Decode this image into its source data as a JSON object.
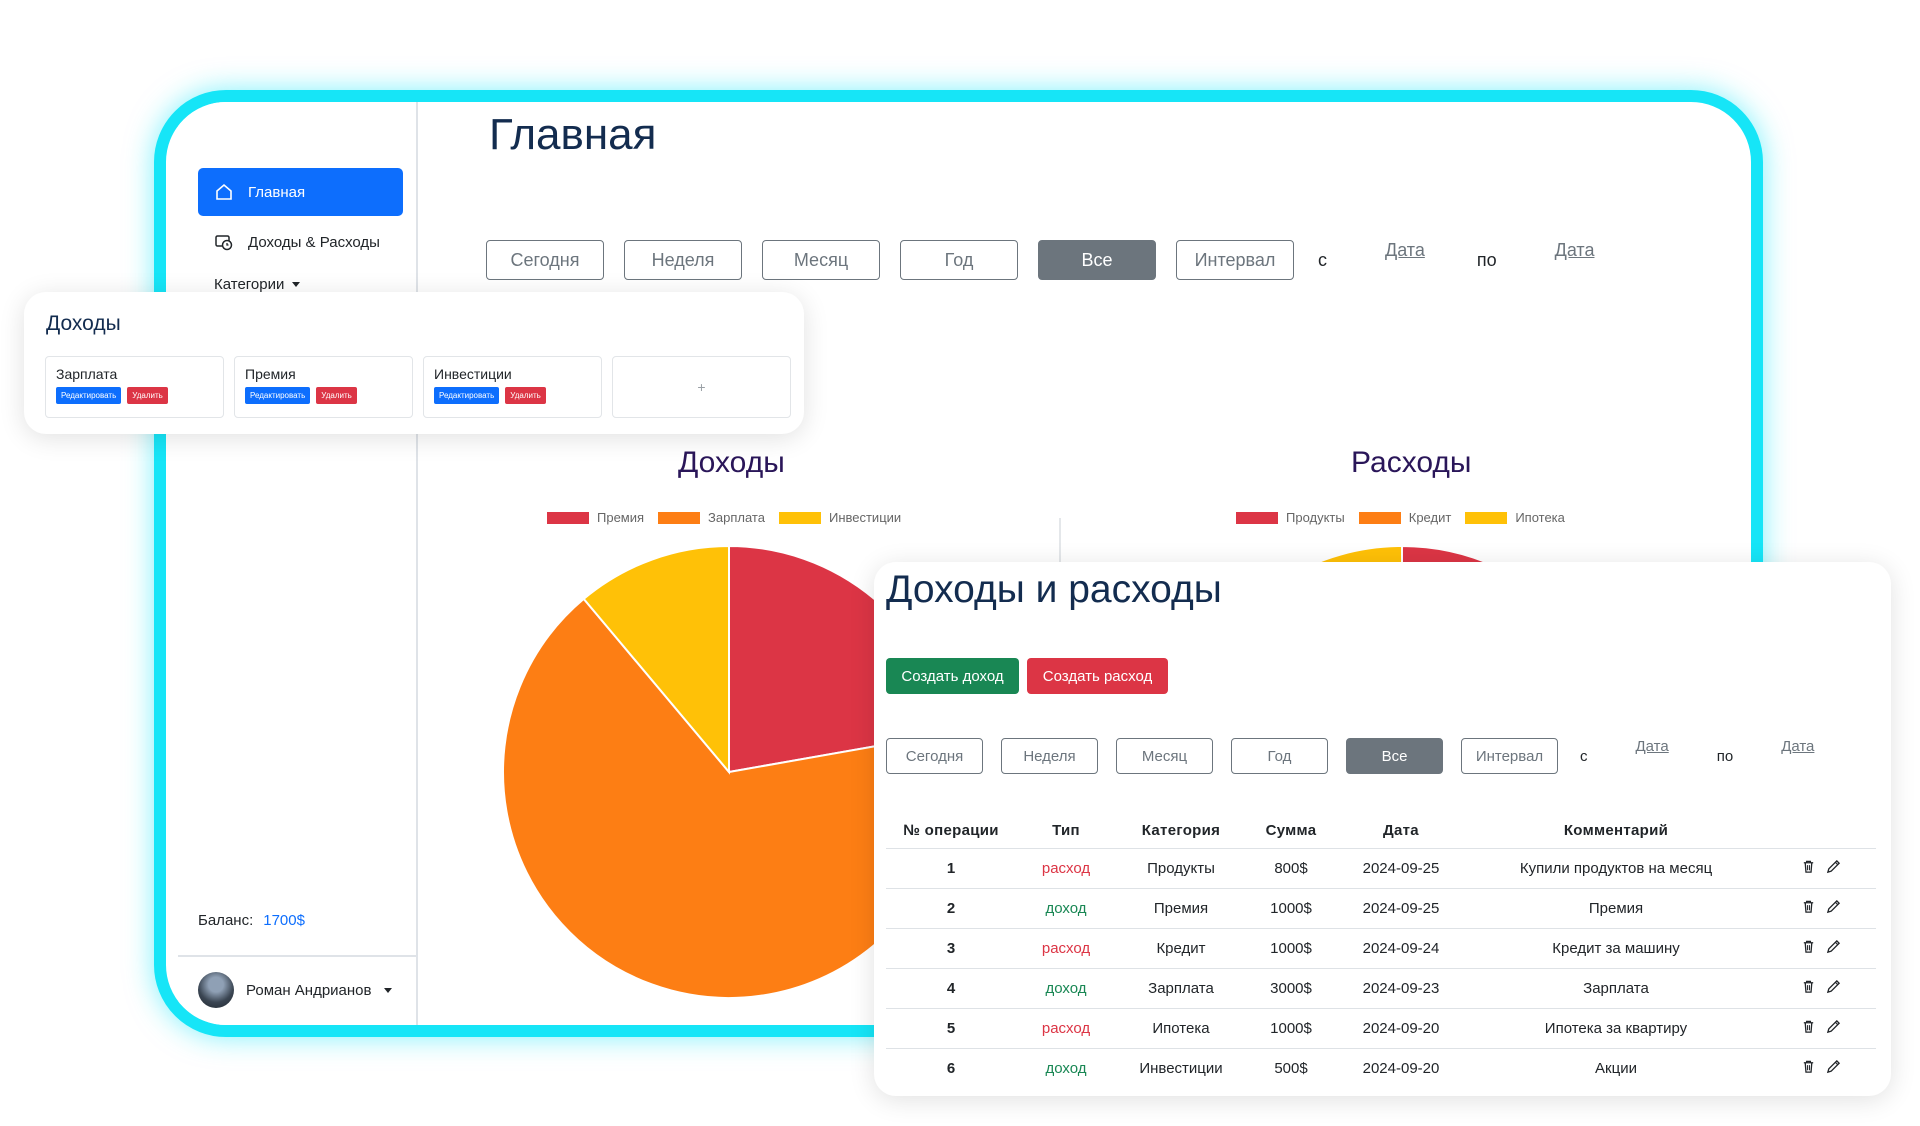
{
  "sidebar": {
    "items": [
      {
        "label": "Главная",
        "icon": "home-icon",
        "active": true
      },
      {
        "label": "Доходы & Расходы",
        "icon": "wallet-icon",
        "active": false
      }
    ],
    "categories_label": "Категории",
    "balance_label": "Баланс:",
    "balance_value": "1700$",
    "user_name": "Роман Андрианов"
  },
  "main": {
    "title": "Главная",
    "filters": {
      "buttons": [
        "Сегодня",
        "Неделя",
        "Месяц",
        "Год",
        "Все",
        "Интервал"
      ],
      "active": "Все",
      "from_label": "с",
      "to_label": "по",
      "date_from": "Дата",
      "date_to": "Дата"
    }
  },
  "chart_data": [
    {
      "type": "pie",
      "title": "Доходы",
      "categories": [
        "Премия",
        "Зарплата",
        "Инвестиции"
      ],
      "values": [
        1000,
        3000,
        500
      ],
      "colors": [
        "#dc3545",
        "#fd7e14",
        "#ffc107"
      ]
    },
    {
      "type": "pie",
      "title": "Расходы",
      "categories": [
        "Продукты",
        "Кредит",
        "Ипотека"
      ],
      "values": [
        800,
        1000,
        1000
      ],
      "colors": [
        "#dc3545",
        "#fd7e14",
        "#ffc107"
      ]
    }
  ],
  "income_card": {
    "title": "Доходы",
    "edit_label": "Редактировать",
    "delete_label": "Удалить",
    "add_label": "+",
    "categories": [
      "Зарплата",
      "Премия",
      "Инвестиции"
    ]
  },
  "ops_card": {
    "title": "Доходы и расходы",
    "create_income": "Создать доход",
    "create_expense": "Создать расход",
    "filters": {
      "buttons": [
        "Сегодня",
        "Неделя",
        "Месяц",
        "Год",
        "Все",
        "Интервал"
      ],
      "active": "Все",
      "from_label": "с",
      "to_label": "по",
      "date_from": "Дата",
      "date_to": "Дата"
    },
    "columns": [
      "№ операции",
      "Тип",
      "Категория",
      "Сумма",
      "Дата",
      "Комментарий"
    ],
    "rows": [
      {
        "num": "1",
        "type": "расход",
        "kind": "expense",
        "category": "Продукты",
        "amount": "800$",
        "date": "2024-09-25",
        "comment": "Купили продуктов на месяц"
      },
      {
        "num": "2",
        "type": "доход",
        "kind": "income",
        "category": "Премия",
        "amount": "1000$",
        "date": "2024-09-25",
        "comment": "Премия"
      },
      {
        "num": "3",
        "type": "расход",
        "kind": "expense",
        "category": "Кредит",
        "amount": "1000$",
        "date": "2024-09-24",
        "comment": "Кредит за машину"
      },
      {
        "num": "4",
        "type": "доход",
        "kind": "income",
        "category": "Зарплата",
        "amount": "3000$",
        "date": "2024-09-23",
        "comment": "Зарплата"
      },
      {
        "num": "5",
        "type": "расход",
        "kind": "expense",
        "category": "Ипотека",
        "amount": "1000$",
        "date": "2024-09-20",
        "comment": "Ипотека за квартиру"
      },
      {
        "num": "6",
        "type": "доход",
        "kind": "income",
        "category": "Инвестиции",
        "amount": "500$",
        "date": "2024-09-20",
        "comment": "Акции"
      }
    ]
  }
}
